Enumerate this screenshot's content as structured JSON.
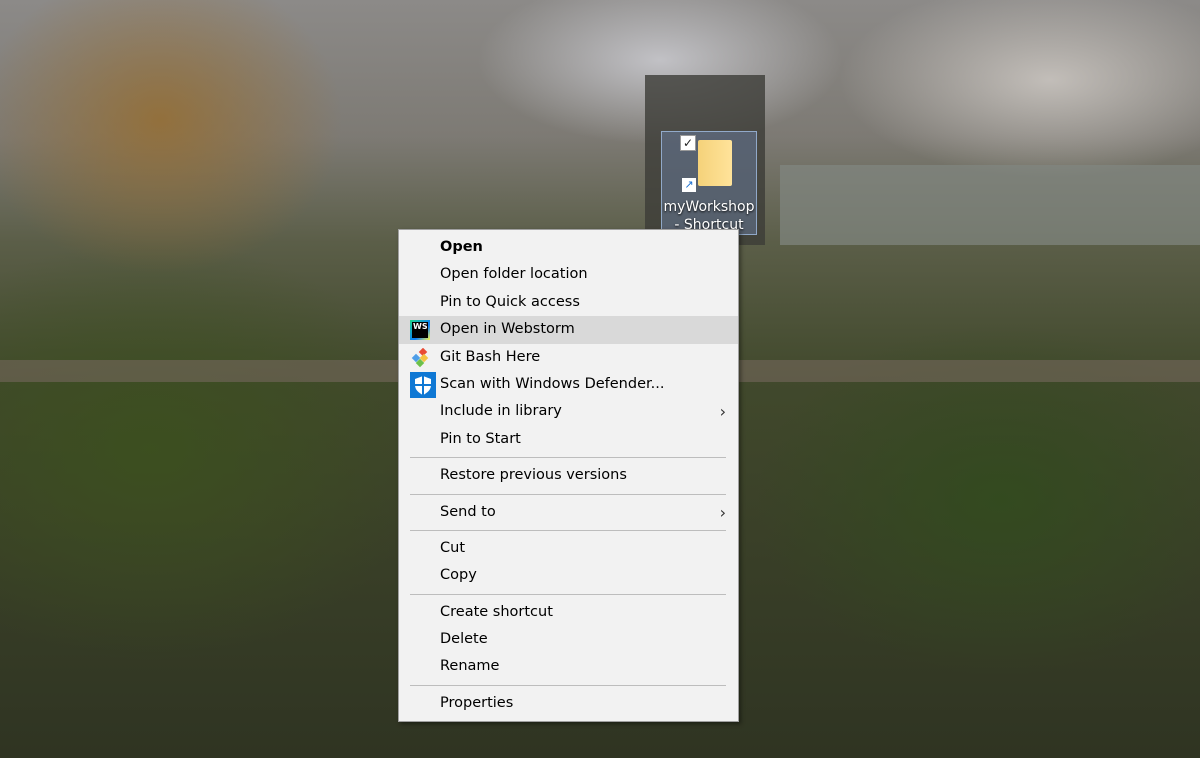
{
  "desktop_icon": {
    "label": "myWorkshop - Shortcut",
    "checked": true
  },
  "menu": {
    "items": [
      {
        "label": "Open",
        "bold": true
      },
      {
        "label": "Open folder location"
      },
      {
        "label": "Pin to Quick access"
      },
      {
        "label": "Open in Webstorm",
        "icon": "webstorm-icon",
        "highlighted": true
      },
      {
        "label": "Git Bash Here",
        "icon": "git-icon"
      },
      {
        "label": "Scan with Windows Defender...",
        "icon": "defender-shield-icon"
      },
      {
        "label": "Include in library",
        "submenu": true
      },
      {
        "label": "Pin to Start"
      },
      {
        "label": "Restore previous versions"
      },
      {
        "label": "Send to",
        "submenu": true
      },
      {
        "label": "Cut"
      },
      {
        "label": "Copy"
      },
      {
        "label": "Create shortcut"
      },
      {
        "label": "Delete"
      },
      {
        "label": "Rename"
      },
      {
        "label": "Properties"
      }
    ],
    "submenu_glyph": "›",
    "check_glyph": "✓",
    "shortcut_glyph": "↗",
    "ws_text": "WS"
  }
}
